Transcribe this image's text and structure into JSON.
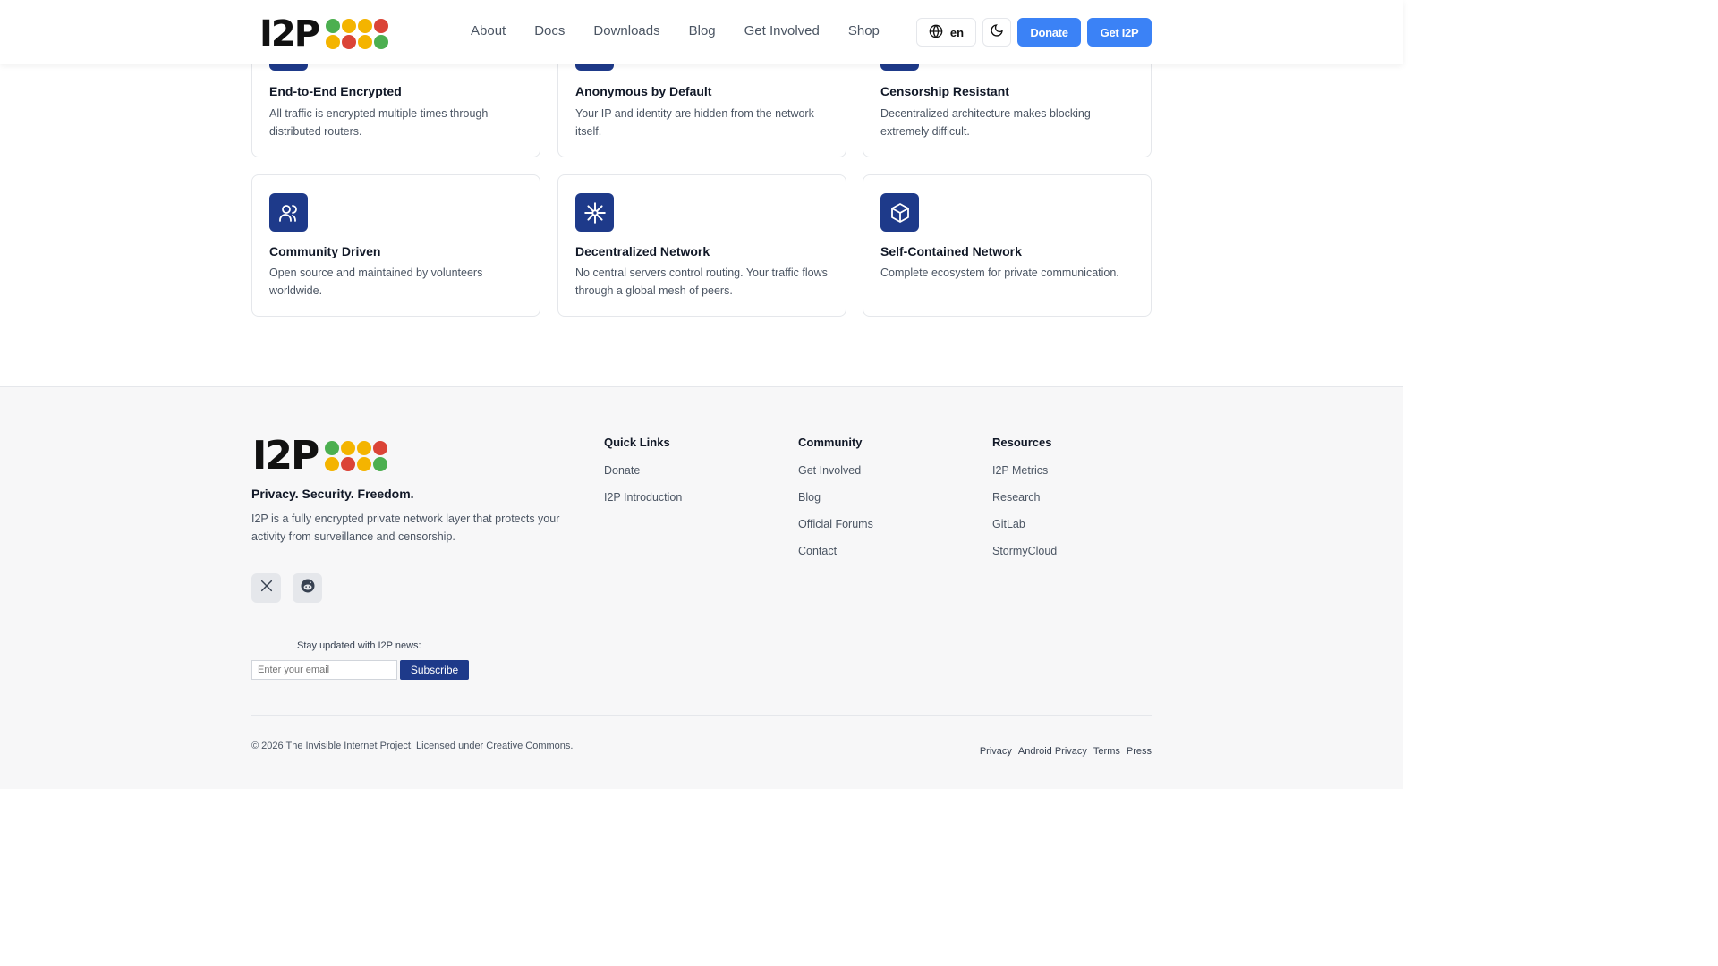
{
  "header": {
    "logo_text": "I2P",
    "nav": [
      "About",
      "Docs",
      "Downloads",
      "Blog",
      "Get Involved",
      "Shop"
    ],
    "lang": "en",
    "donate_label": "Donate",
    "get_label": "Get I2P"
  },
  "logo_dot_colors": [
    "#4caf50",
    "#f4b400",
    "#f4b400",
    "#db4437",
    "#f4b400",
    "#db4437",
    "#f4b400",
    "#4caf50"
  ],
  "features": [
    {
      "title": "End-to-End Encrypted",
      "desc": "All traffic is encrypted multiple times through distributed routers.",
      "icon": "lock-icon"
    },
    {
      "title": "Anonymous by Default",
      "desc": "Your IP and identity are hidden from the network itself.",
      "icon": "eye-off-icon"
    },
    {
      "title": "Censorship Resistant",
      "desc": "Decentralized architecture makes blocking extremely difficult.",
      "icon": "shield-icon"
    },
    {
      "title": "Community Driven",
      "desc": "Open source and maintained by volunteers worldwide.",
      "icon": "users-icon"
    },
    {
      "title": "Decentralized Network",
      "desc": "No central servers control routing. Your traffic flows through a global mesh of peers.",
      "icon": "network-icon"
    },
    {
      "title": "Self-Contained Network",
      "desc": "Complete ecosystem for private communication.",
      "icon": "cube-icon"
    }
  ],
  "footer": {
    "logo_text": "I2P",
    "tagline": "Privacy. Security. Freedom.",
    "about": "I2P is a fully encrypted private network layer that protects your activity from surveillance and censorship.",
    "newsletter_label": "Stay updated with I2P news:",
    "email_placeholder": "Enter your email",
    "subscribe_label": "Subscribe",
    "columns": [
      {
        "title": "Quick Links",
        "links": [
          "Donate",
          "I2P Introduction"
        ]
      },
      {
        "title": "Community",
        "links": [
          "Get Involved",
          "Blog",
          "Official Forums",
          "Contact"
        ]
      },
      {
        "title": "Resources",
        "links": [
          "I2P Metrics",
          "Research",
          "GitLab",
          "StormyCloud"
        ]
      }
    ],
    "copyright": "© 2026 The Invisible Internet Project. Licensed under Creative Commons.",
    "legal": [
      "Privacy",
      "Android Privacy",
      "Terms",
      "Press"
    ]
  },
  "colors": {
    "accent": "#3b82f6",
    "icon_bg": "#1e3a8a"
  }
}
